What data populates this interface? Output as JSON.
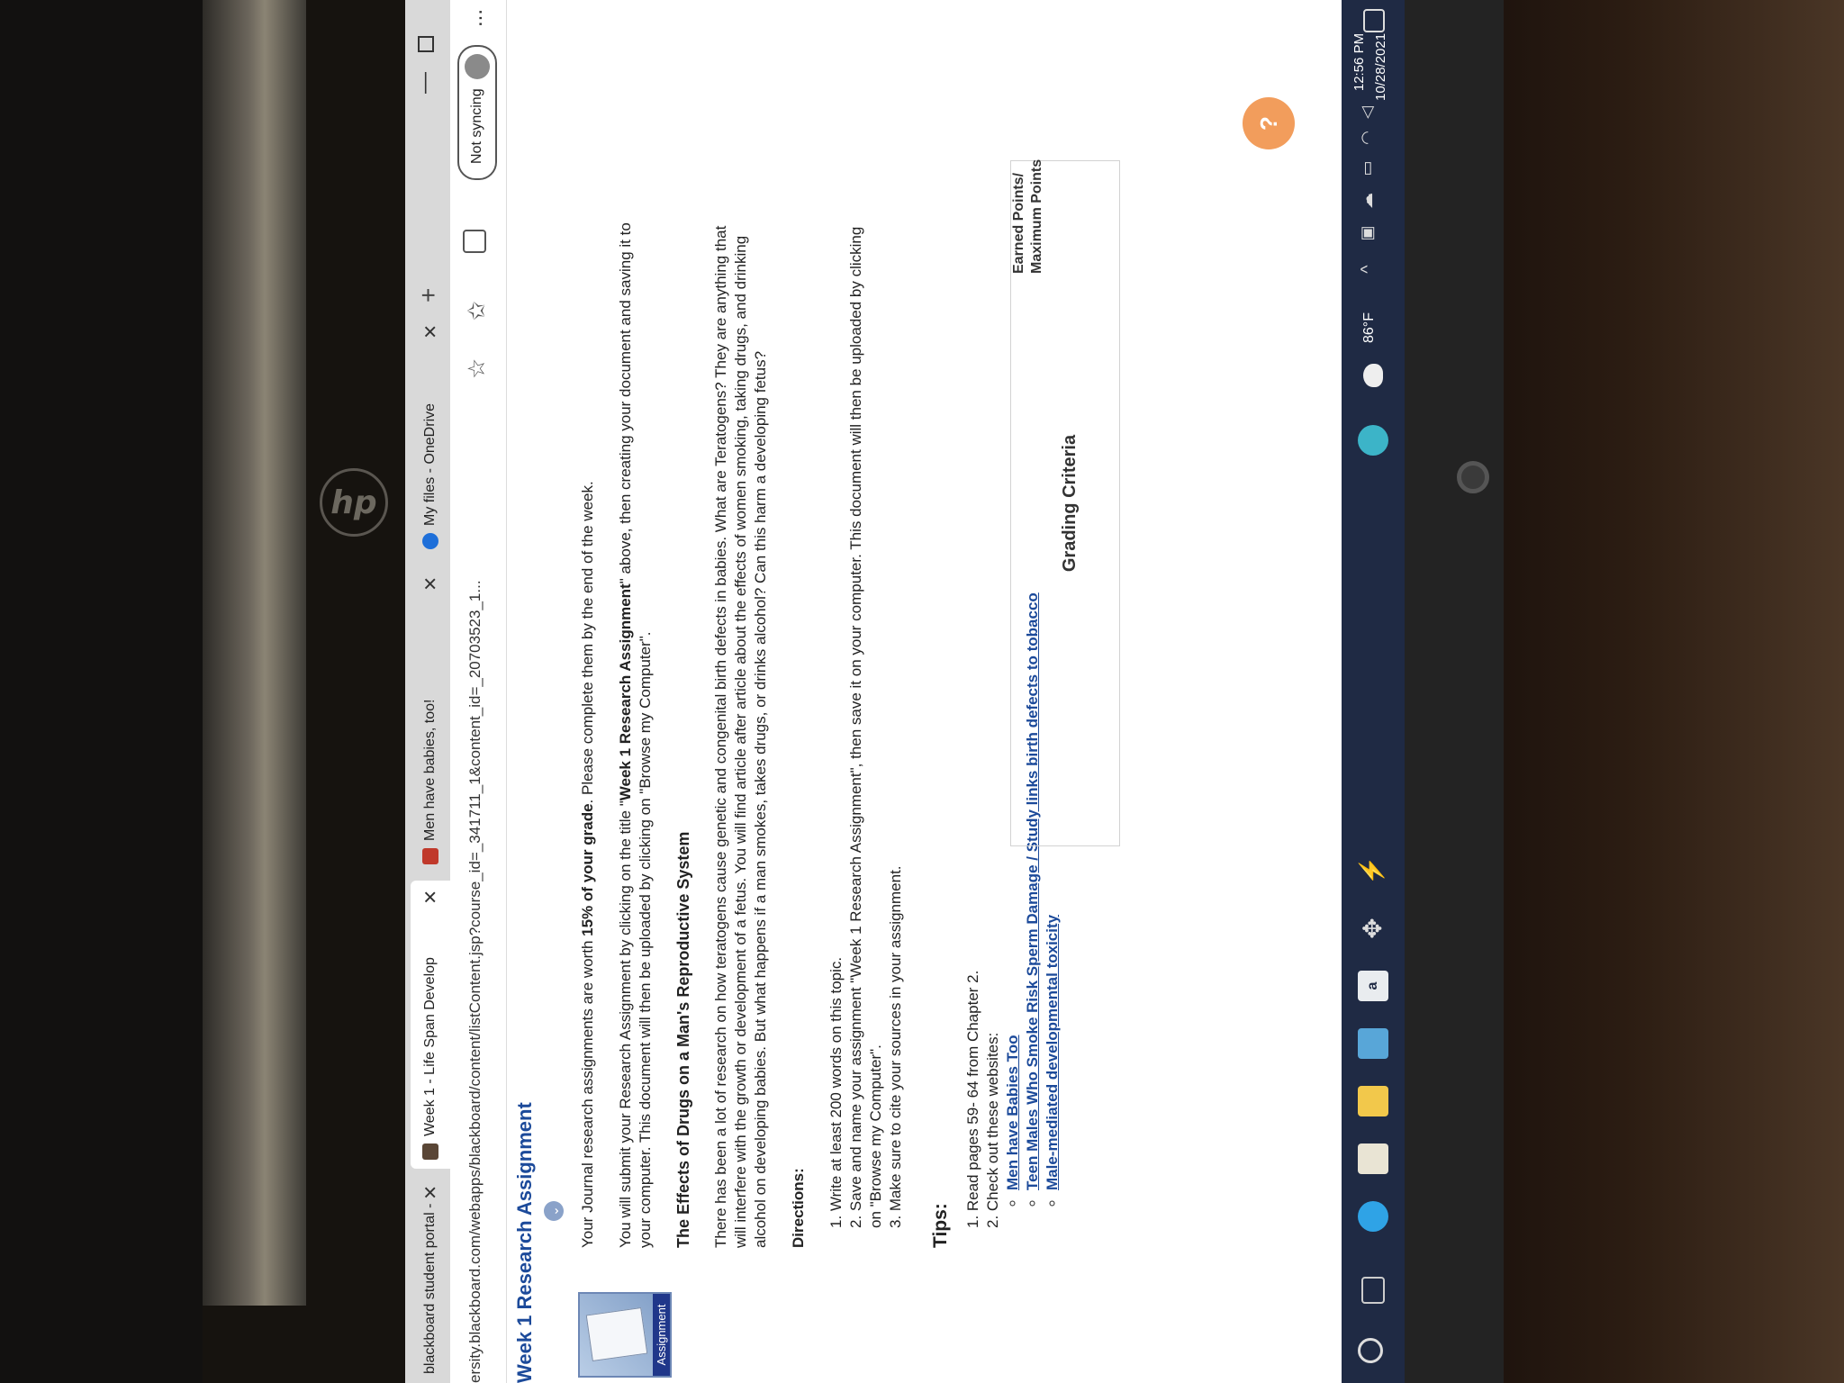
{
  "browser": {
    "tabs": [
      {
        "label": "blackboard student portal -",
        "color": "#e8e8e8"
      },
      {
        "label": "Week 1 - Life Span Develop",
        "color": "#5a4636"
      },
      {
        "label": "Men have babies, too!",
        "color": "#c0392b"
      },
      {
        "label": "My files - OneDrive",
        "color": "#1e6fd9"
      }
    ],
    "new_tab": "+",
    "url": "ersity.blackboard.com/webapps/blackboard/content/listContent.jsp?course_id=_341711_1&content_id=_20703523_1...",
    "sync_label": "Not syncing",
    "more": "..."
  },
  "item": {
    "title": "Week 1 Research Assignment",
    "icon_label": "Assignment",
    "intro_p1_a": "Your Journal research assignments are worth ",
    "intro_p1_b": "15% of your grade",
    "intro_p1_c": ". Please complete them by the end of the week.",
    "intro_p2_a": "You will submit your Research Assignment by clicking on the title \"",
    "intro_p2_b": "Week 1 Research Assignment",
    "intro_p2_c": "\" above, then creating your document and saving it to your computer.  This document will then be uploaded by clicking on \"Browse my Computer\".",
    "heading": "The Effects of Drugs on a Man's Reproductive System",
    "body": "There has been a lot of research on how teratogens cause genetic and congenital birth defects in babies. What are Teratogens?  They are anything that will interfere with the growth or development of a fetus. You will find article after article about the effects of women smoking, taking drugs, and drinking alcohol on developing babies.  But what happens if a man smokes, takes drugs, or drinks alcohol?  Can this harm a developing fetus?",
    "directions_label": "Directions:",
    "directions": [
      "1. Write at least 200 words on this topic.",
      "2. Save and name your assignment \"Week 1 Research Assignment\", then save it on your computer.  This document will then be uploaded by clicking on \"Browse my Computer\".",
      "3. Make sure to cite your sources in your assignment."
    ],
    "tips_label": "Tips:",
    "tips": [
      "1. Read pages 59- 64 from Chapter 2.",
      "2. Check out these websites:"
    ],
    "links": [
      "Men have Babies Too",
      "Teen Males Who Smoke Risk Sperm Damage / Study links birth defects to tobacco",
      "Male-mediated developmental toxicity"
    ],
    "grading_title": "Grading Criteria",
    "points_line1": "Earned Points/",
    "points_line2": "Maximum Points",
    "help": "?"
  },
  "taskbar": {
    "temperature": "86°F",
    "time": "12:56 PM",
    "date": "10/28/2021"
  },
  "hardware": {
    "logo": "hp"
  }
}
